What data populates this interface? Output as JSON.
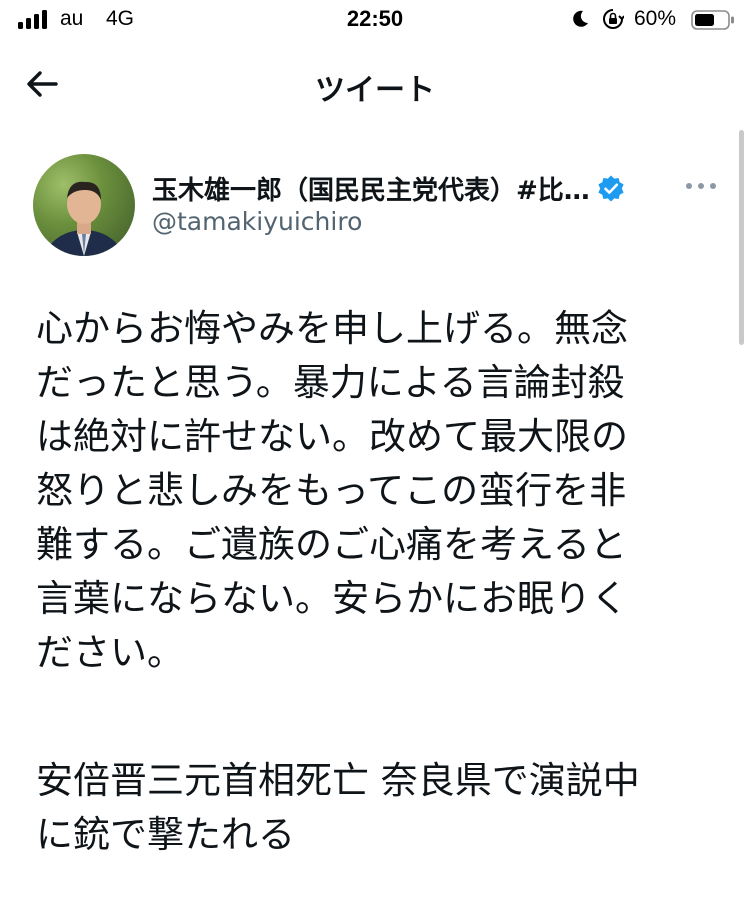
{
  "status_bar": {
    "carrier": "au",
    "network": "4G",
    "time": "22:50",
    "battery_percent": "60%",
    "icons": [
      "signal-icon",
      "moon-icon",
      "orientation-lock-icon",
      "battery-icon"
    ]
  },
  "header": {
    "title": "ツイート",
    "back_icon": "arrow-left-icon"
  },
  "tweet": {
    "author": {
      "display_name": "玉木雄一郎（国民民主党代表）#比…",
      "handle": "@tamakiyuichiro",
      "verified": true,
      "verified_color": "#1d9bf0"
    },
    "text": "心からお悔やみを申し上げる。無念\nだったと思う。暴力による言論封殺\nは絶対に許せない。改めて最大限の\n怒りと悲しみをもってこの蛮行を非\n難する。ご遺族のご心痛を考えると\n言葉にならない。安らかにお眠りく\nださい。",
    "linked_card_title": "安倍晋三元首相死亡 奈良県で演説中\nに銃で撃たれる"
  },
  "colors": {
    "text_primary": "#0f1419",
    "text_secondary": "#536471",
    "accent": "#1d9bf0"
  }
}
